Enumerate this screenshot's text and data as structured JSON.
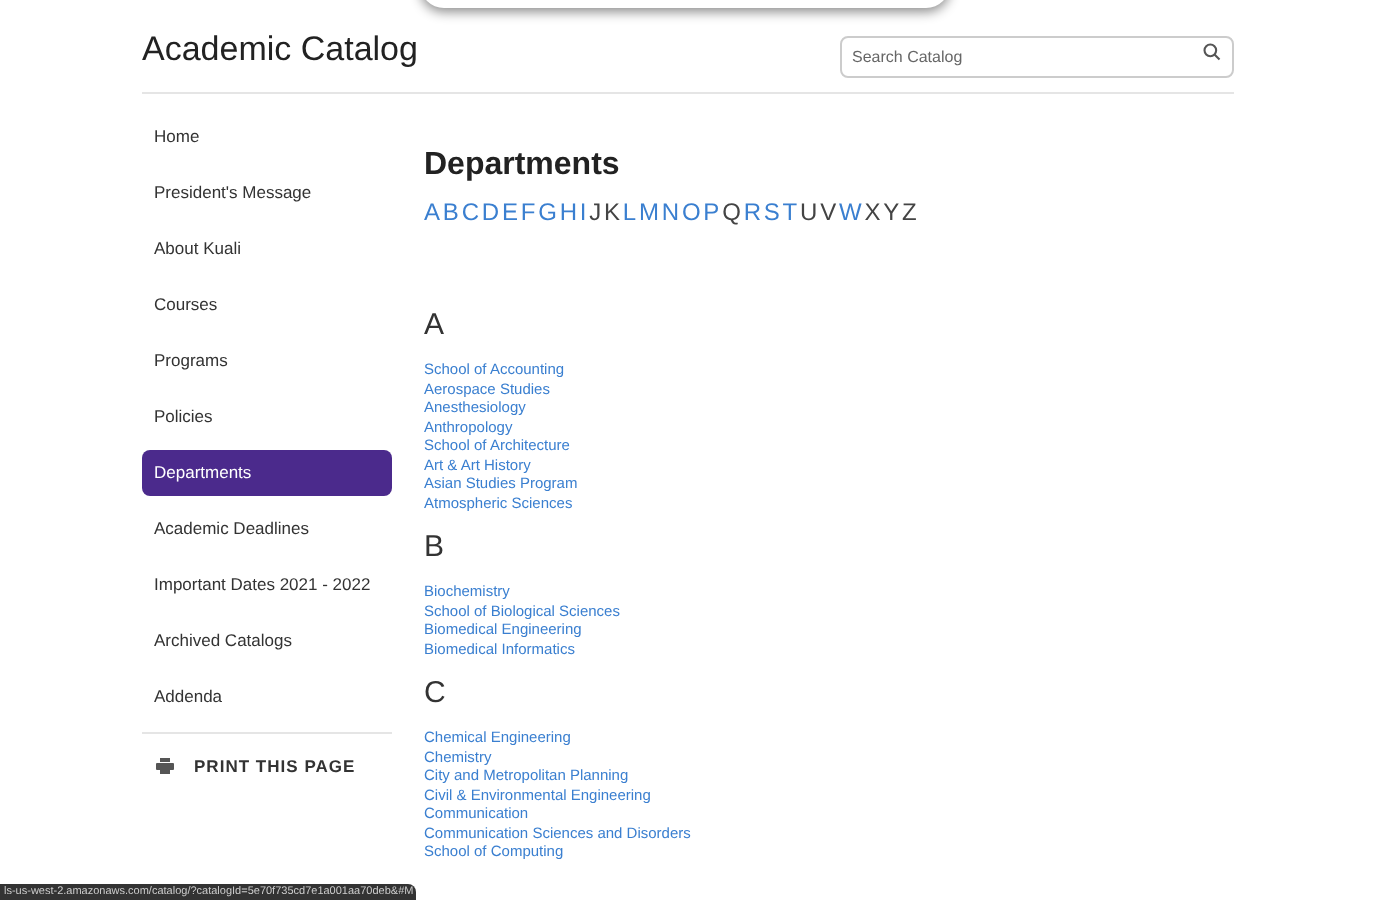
{
  "header": {
    "title": "Academic Catalog",
    "search": {
      "placeholder": "Search Catalog"
    }
  },
  "sidebar": {
    "items": [
      {
        "label": "Home",
        "selected": false
      },
      {
        "label": "President's Message",
        "selected": false
      },
      {
        "label": "About Kuali",
        "selected": false
      },
      {
        "label": "Courses",
        "selected": false
      },
      {
        "label": "Programs",
        "selected": false
      },
      {
        "label": "Policies",
        "selected": false
      },
      {
        "label": "Departments",
        "selected": true
      },
      {
        "label": "Academic Deadlines",
        "selected": false
      },
      {
        "label": "Important Dates 2021 - 2022",
        "selected": false
      },
      {
        "label": "Archived Catalogs",
        "selected": false
      },
      {
        "label": "Addenda",
        "selected": false
      }
    ],
    "print": "PRINT THIS PAGE"
  },
  "main": {
    "title": "Departments",
    "letters": [
      {
        "label": "A",
        "linked": true
      },
      {
        "label": "B",
        "linked": true
      },
      {
        "label": "C",
        "linked": true
      },
      {
        "label": "D",
        "linked": true
      },
      {
        "label": "E",
        "linked": true
      },
      {
        "label": "F",
        "linked": true
      },
      {
        "label": "G",
        "linked": true
      },
      {
        "label": "H",
        "linked": true
      },
      {
        "label": "I",
        "linked": true
      },
      {
        "label": "J",
        "linked": false
      },
      {
        "label": "K",
        "linked": false
      },
      {
        "label": "L",
        "linked": true
      },
      {
        "label": "M",
        "linked": true
      },
      {
        "label": "N",
        "linked": true
      },
      {
        "label": "O",
        "linked": true
      },
      {
        "label": "P",
        "linked": true
      },
      {
        "label": "Q",
        "linked": false
      },
      {
        "label": "R",
        "linked": true
      },
      {
        "label": "S",
        "linked": true
      },
      {
        "label": "T",
        "linked": true
      },
      {
        "label": "U",
        "linked": false
      },
      {
        "label": "V",
        "linked": false
      },
      {
        "label": "W",
        "linked": true
      },
      {
        "label": "X",
        "linked": false
      },
      {
        "label": "Y",
        "linked": false
      },
      {
        "label": "Z",
        "linked": false
      }
    ],
    "sections": [
      {
        "letter": "A",
        "departments": [
          "School of Accounting",
          "Aerospace Studies",
          "Anesthesiology",
          "Anthropology",
          "School of Architecture",
          "Art & Art History",
          "Asian Studies Program",
          "Atmospheric Sciences"
        ]
      },
      {
        "letter": "B",
        "departments": [
          "Biochemistry",
          "School of Biological Sciences",
          "Biomedical Engineering",
          "Biomedical Informatics"
        ]
      },
      {
        "letter": "C",
        "departments": [
          "Chemical Engineering",
          "Chemistry",
          "City and Metropolitan Planning",
          "Civil & Environmental Engineering",
          "Communication",
          "Communication Sciences and Disorders",
          "School of Computing"
        ]
      }
    ]
  },
  "status_bar": {
    "url": "ls-us-west-2.amazonaws.com/catalog/?catalogId=5e70f735cd7e1a001aa70deb&#M"
  }
}
